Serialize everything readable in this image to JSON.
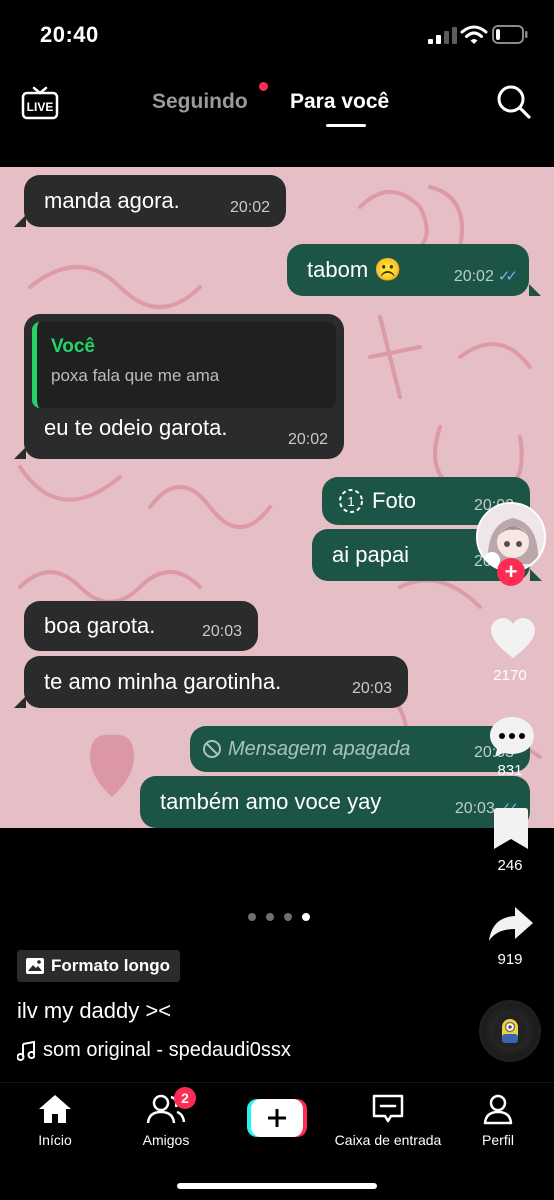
{
  "status_bar": {
    "time": "20:40"
  },
  "top_nav": {
    "live_label": "LIVE",
    "tab_following": "Seguindo",
    "tab_for_you": "Para você"
  },
  "chat": {
    "messages": [
      {
        "dir": "in",
        "text": "manda agora.",
        "time": "20:02"
      },
      {
        "dir": "out",
        "text": "tabom ☹️",
        "time": "20:02",
        "read": true
      },
      {
        "dir": "in",
        "quote_name": "Você",
        "quote_text": "poxa fala que me ama",
        "text": "eu te odeio garota.",
        "time": "20:02"
      },
      {
        "dir": "out",
        "text": "Foto",
        "time": "20:02",
        "icon": "view-once-icon"
      },
      {
        "dir": "out",
        "text": "ai papai",
        "time": "20:03"
      },
      {
        "dir": "in",
        "text": "boa garota.",
        "time": "20:03"
      },
      {
        "dir": "in",
        "text": "te amo minha garotinha.",
        "time": "20:03"
      },
      {
        "dir": "out",
        "text": "Mensagem apagada",
        "time": "20:03",
        "deleted": true
      },
      {
        "dir": "out",
        "text": "também amo voce yay",
        "time": "20:03",
        "read": true
      }
    ]
  },
  "rail": {
    "likes": "2170",
    "comments": "831",
    "saves": "246",
    "shares": "919"
  },
  "pager": {
    "total": 4,
    "active": 4
  },
  "video_info": {
    "format_tag": "Formato longo",
    "caption": "ilv my daddy ><",
    "sound": "som original - spedaudi0ssx"
  },
  "bottom_nav": {
    "home": "Início",
    "friends": "Amigos",
    "friends_badge": "2",
    "inbox": "Caixa de entrada",
    "profile": "Perfil"
  },
  "colors": {
    "accent": "#fe2c55",
    "bubble_in": "#2a2b2b",
    "bubble_out": "#1c5546",
    "chat_wallpaper": "#e6bec6"
  }
}
